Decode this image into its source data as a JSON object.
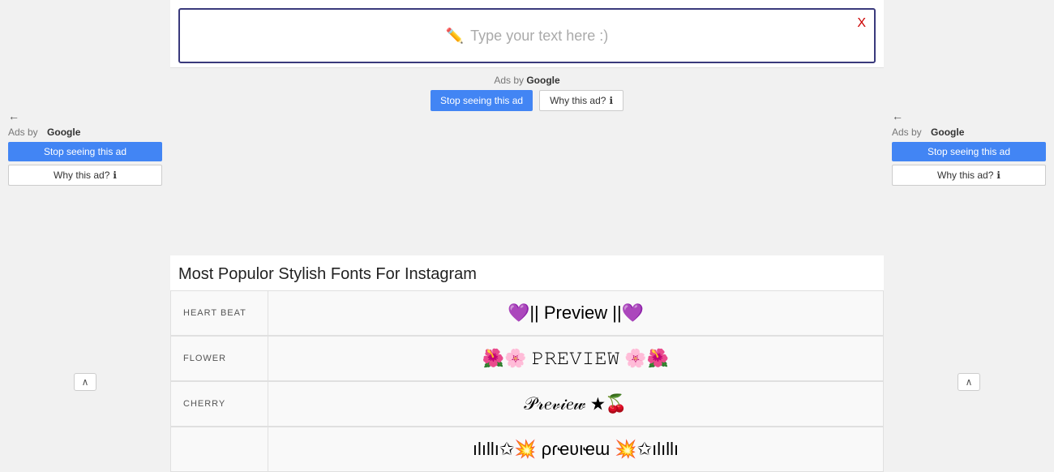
{
  "header": {
    "input_placeholder": "✏️ Type your text here :)",
    "close_label": "X"
  },
  "ads_center_top": {
    "label": "Ads by",
    "google_label": "Google",
    "stop_label": "Stop seeing this ad",
    "why_label": "Why this ad?",
    "why_info": "ℹ"
  },
  "ads_left": {
    "label": "Ads by",
    "google_label": "Google",
    "stop_label": "Stop seeing this ad",
    "why_label": "Why this ad?",
    "why_info": "ℹ",
    "back_arrow": "←"
  },
  "ads_right": {
    "label": "Ads by",
    "google_label": "Google",
    "stop_label": "Stop seeing this ad",
    "why_label": "Why this ad?",
    "why_info": "ℹ",
    "back_arrow": "←"
  },
  "section": {
    "title": "Most Populor Stylish Fonts For Instagram"
  },
  "fonts": [
    {
      "label": "HEART BEAT",
      "preview": "💜|| Preview ||💜"
    },
    {
      "label": "FLOWER",
      "preview": "🌺🌸 𝙿𝚁𝙴𝚅𝙸𝙴𝚆 🌸🌺"
    },
    {
      "label": "CHERRY",
      "preview": "𝒫𝓇𝑒𝓋𝒾𝑒𝓌 ★🍒"
    },
    {
      "label": "",
      "preview": "ılıllı✩💥 ρɾҽʋιҽɯ 💥✩ılıllı"
    }
  ],
  "up_arrow": "∧"
}
